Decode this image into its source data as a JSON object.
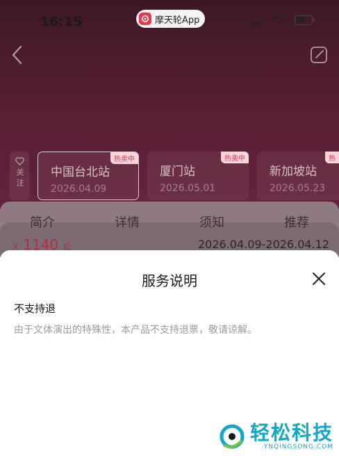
{
  "status_bar": {
    "time": "16:15",
    "app_pill": "摩天轮App"
  },
  "colors": {
    "accent": "#d43a56",
    "background_top": "#5a1f35",
    "watermark": "#12a6c7"
  },
  "follow": {
    "label": "关注"
  },
  "cities": [
    {
      "name": "中国台北站",
      "date": "2026.04.09",
      "badge": "热卖中",
      "selected": true
    },
    {
      "name": "厦门站",
      "date": "2026.05.01",
      "badge": "热卖中",
      "selected": false
    },
    {
      "name": "新加坡站",
      "date": "2026.05.23",
      "badge": "热",
      "selected": false
    }
  ],
  "tabs": [
    "简介",
    "详情",
    "须知",
    "推荐"
  ],
  "price": {
    "prefix": "x",
    "amount": "1140",
    "unit": "起"
  },
  "date_range": "2026.04.09-2026.04.12",
  "sheet": {
    "title": "服务说明",
    "section_title": "不支持退",
    "section_body": "由于文体演出的特殊性，本产品不支持退票，敬请谅解。"
  },
  "watermark": {
    "text": "轻松科技",
    "sub": "YNQINGSONG.COM"
  }
}
